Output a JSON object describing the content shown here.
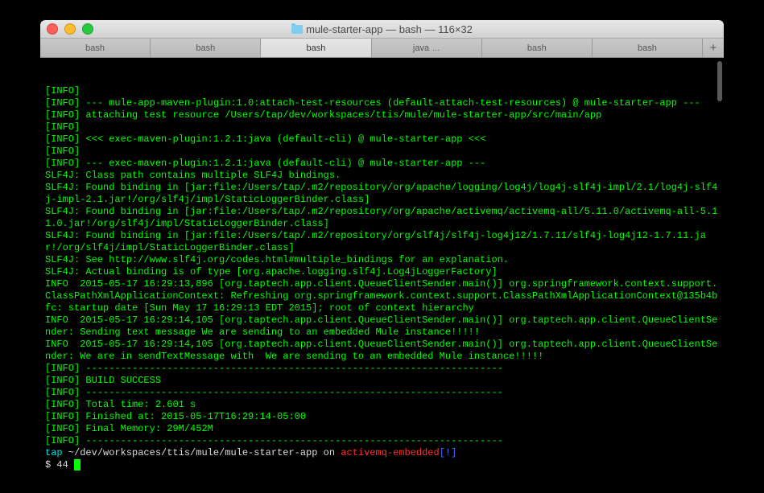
{
  "window": {
    "title": "mule-starter-app — bash — 116×32"
  },
  "tabs": {
    "items": [
      {
        "label": "bash",
        "active": false,
        "extra": ""
      },
      {
        "label": "bash",
        "active": false,
        "extra": ""
      },
      {
        "label": "bash",
        "active": true,
        "extra": ""
      },
      {
        "label": "java",
        "active": false,
        "extra": "..."
      },
      {
        "label": "bash",
        "active": false,
        "extra": ""
      },
      {
        "label": "bash",
        "active": false,
        "extra": ""
      }
    ]
  },
  "terminal": {
    "lines": [
      {
        "segments": [
          {
            "t": "[INFO]",
            "c": "info-tag"
          }
        ]
      },
      {
        "segments": [
          {
            "t": "[INFO]",
            "c": "info-tag"
          },
          {
            "t": " --- mule-app-maven-plugin:1.0:attach-test-resources (default-attach-test-resources) @ mule-starter-app ---",
            "c": "log-green"
          }
        ]
      },
      {
        "segments": [
          {
            "t": "[INFO]",
            "c": "info-tag"
          },
          {
            "t": " attaching test resource /Users/tap/dev/workspaces/ttis/mule/mule-starter-app/src/main/app",
            "c": "log-green"
          }
        ]
      },
      {
        "segments": [
          {
            "t": "[INFO]",
            "c": "info-tag"
          }
        ]
      },
      {
        "segments": [
          {
            "t": "[INFO]",
            "c": "info-tag"
          },
          {
            "t": " <<< exec-maven-plugin:1.2.1:java (default-cli) @ mule-starter-app <<<",
            "c": "log-green"
          }
        ]
      },
      {
        "segments": [
          {
            "t": "[INFO]",
            "c": "info-tag"
          }
        ]
      },
      {
        "segments": [
          {
            "t": "[INFO]",
            "c": "info-tag"
          },
          {
            "t": " --- exec-maven-plugin:1.2.1:java (default-cli) @ mule-starter-app ---",
            "c": "log-green"
          }
        ]
      },
      {
        "segments": [
          {
            "t": "SLF4J: Class path contains multiple SLF4J bindings.",
            "c": "log-green"
          }
        ]
      },
      {
        "segments": [
          {
            "t": "SLF4J: Found binding in [jar:file:/Users/tap/.m2/repository/org/apache/logging/log4j/log4j-slf4j-impl/2.1/log4j-slf4j-impl-2.1.jar!/org/slf4j/impl/StaticLoggerBinder.class]",
            "c": "log-green"
          }
        ]
      },
      {
        "segments": [
          {
            "t": "SLF4J: Found binding in [jar:file:/Users/tap/.m2/repository/org/apache/activemq/activemq-all/5.11.0/activemq-all-5.11.0.jar!/org/slf4j/impl/StaticLoggerBinder.class]",
            "c": "log-green"
          }
        ]
      },
      {
        "segments": [
          {
            "t": "SLF4J: Found binding in [jar:file:/Users/tap/.m2/repository/org/slf4j/slf4j-log4j12/1.7.11/slf4j-log4j12-1.7.11.jar!/org/slf4j/impl/StaticLoggerBinder.class]",
            "c": "log-green"
          }
        ]
      },
      {
        "segments": [
          {
            "t": "SLF4J: See http://www.slf4j.org/codes.html#multiple_bindings for an explanation.",
            "c": "log-green"
          }
        ]
      },
      {
        "segments": [
          {
            "t": "SLF4J: Actual binding is of type [org.apache.logging.slf4j.Log4jLoggerFactory]",
            "c": "log-green"
          }
        ]
      },
      {
        "segments": [
          {
            "t": "INFO  2015-05-17 16:29:13,896 [org.taptech.app.client.QueueClientSender.main()] org.springframework.context.support.ClassPathXmlApplicationContext: Refreshing org.springframework.context.support.ClassPathXmlApplicationContext@135b4bfc: startup date [Sun May 17 16:29:13 EDT 2015]; root of context hierarchy",
            "c": "log-green"
          }
        ]
      },
      {
        "segments": [
          {
            "t": "INFO  2015-05-17 16:29:14,105 [org.taptech.app.client.QueueClientSender.main()] org.taptech.app.client.QueueClientSender: Sending text message We are sending to an embedded Mule instance!!!!!",
            "c": "log-green"
          }
        ]
      },
      {
        "segments": [
          {
            "t": "INFO  2015-05-17 16:29:14,105 [org.taptech.app.client.QueueClientSender.main()] org.taptech.app.client.QueueClientSender: We are in sendTextMessage with  We are sending to an embedded Mule instance!!!!!",
            "c": "log-green"
          }
        ]
      },
      {
        "segments": [
          {
            "t": "[INFO]",
            "c": "info-tag"
          },
          {
            "t": " ------------------------------------------------------------------------",
            "c": "log-green"
          }
        ]
      },
      {
        "segments": [
          {
            "t": "[INFO]",
            "c": "info-tag"
          },
          {
            "t": " BUILD SUCCESS",
            "c": "log-green"
          }
        ]
      },
      {
        "segments": [
          {
            "t": "[INFO]",
            "c": "info-tag"
          },
          {
            "t": " ------------------------------------------------------------------------",
            "c": "log-green"
          }
        ]
      },
      {
        "segments": [
          {
            "t": "[INFO]",
            "c": "info-tag"
          },
          {
            "t": " Total time: 2.601 s",
            "c": "log-green"
          }
        ]
      },
      {
        "segments": [
          {
            "t": "[INFO]",
            "c": "info-tag"
          },
          {
            "t": " Finished at: 2015-05-17T16:29:14-05:00",
            "c": "log-green"
          }
        ]
      },
      {
        "segments": [
          {
            "t": "[INFO]",
            "c": "info-tag"
          },
          {
            "t": " Final Memory: 29M/452M",
            "c": "log-green"
          }
        ]
      },
      {
        "segments": [
          {
            "t": "[INFO]",
            "c": "info-tag"
          },
          {
            "t": " ------------------------------------------------------------------------",
            "c": "log-green"
          }
        ]
      }
    ],
    "prompt": {
      "user": "tap",
      "path": " ~/dev/workspaces/ttis/mule/mule-starter-app",
      "on": " on ",
      "branch": "activemq-embedded",
      "dirty": "[!]",
      "line2_prefix": "$ ",
      "line2_cmd": "44 "
    }
  }
}
